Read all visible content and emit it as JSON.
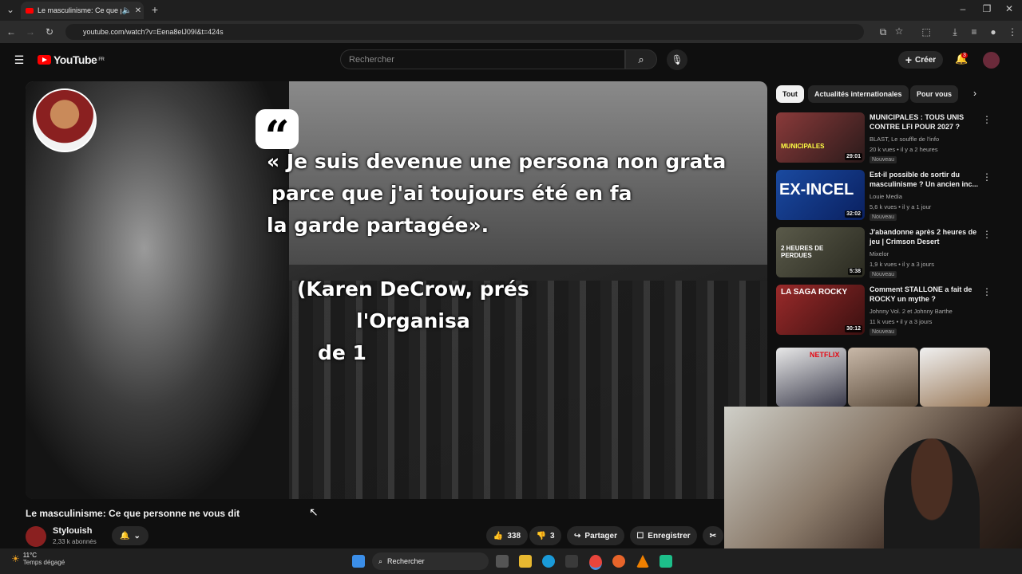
{
  "browser": {
    "tab_title": "Le masculinisme: Ce que pe",
    "url": "youtube.com/watch?v=Eena8elJ09I&t=424s"
  },
  "header": {
    "logo_text": "YouTube",
    "region": "FR",
    "search_placeholder": "Rechercher",
    "create_label": "Créer",
    "notif_count": "3"
  },
  "video": {
    "quote_lines": [
      "« Je suis devenue une persona non grata",
      "parce que j'ai toujours été en fa",
      "la garde partagée»."
    ],
    "attribution_lines": [
      "(Karen DeCrow, prés",
      "l'Organisa",
      "de 1"
    ],
    "title": "Le masculinisme: Ce que personne ne vous dit",
    "channel": "Stylouish",
    "subscribers": "2,33 k abonnés",
    "likes": "338",
    "dislikes": "3",
    "share_label": "Partager",
    "save_label": "Enregistrer"
  },
  "sidebar": {
    "chips": [
      "Tout",
      "Actualités internationales",
      "Pour vous"
    ],
    "recommendations": [
      {
        "title": "MUNICIPALES : TOUS UNIS CONTRE LFI POUR 2027 ?",
        "channel": "BLAST, Le souffle de l'info",
        "meta": "20 k vues • il y a 2 heures",
        "badge": "Nouveau",
        "duration": "29:01",
        "thumb_text": "MUNICIPALES",
        "thumb_color": "#6a2a2a"
      },
      {
        "title": "Est-il possible de sortir du masculinisme ? Un ancien inc...",
        "channel": "Louie Media",
        "meta": "5,6 k vues • il y a 1 jour",
        "badge": "Nouveau",
        "duration": "32:02",
        "thumb_text": "EX-INCEL",
        "thumb_color": "#1a4aa0"
      },
      {
        "title": "J'abandonne après 2 heures de jeu | Crimson Desert",
        "channel": "Mixelor",
        "meta": "1,9 k vues • il y a 3 jours",
        "badge": "Nouveau",
        "duration": "5:38",
        "thumb_text": "2 HEURES DE PERDUES",
        "thumb_color": "#4a4a3a"
      },
      {
        "title": "Comment STALLONE a fait de ROCKY un mythe ?",
        "channel": "Johnny Vol. 2 et Johnny Barthe",
        "meta": "11 k vues • il y a 3 jours",
        "badge": "Nouveau",
        "duration": "30:12",
        "thumb_text": "LA SAGA ROCKY",
        "thumb_color": "#7a1a1a"
      }
    ],
    "shelf_label": "NETFLIX"
  },
  "taskbar": {
    "temperature": "11°C",
    "weather": "Temps dégagé",
    "search_label": "Rechercher"
  }
}
